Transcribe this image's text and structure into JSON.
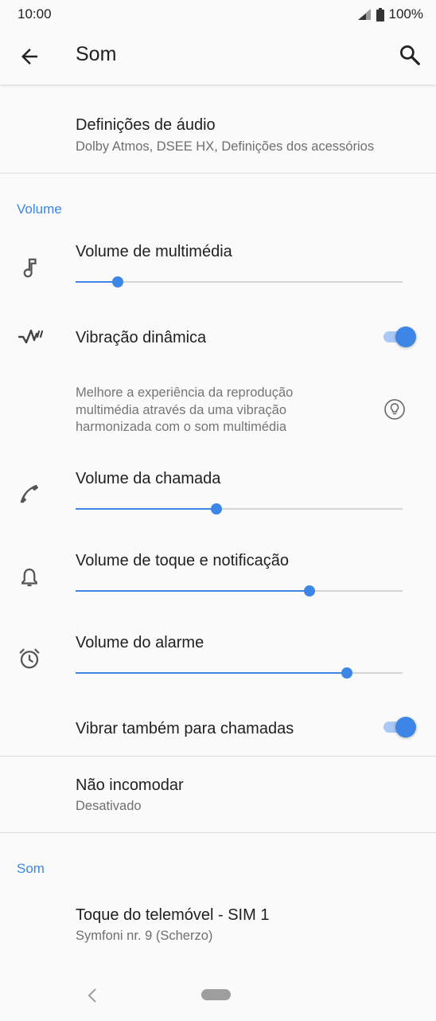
{
  "status_bar": {
    "time": "10:00",
    "battery": "100%"
  },
  "app_bar": {
    "title": "Som"
  },
  "audio_settings": {
    "title": "Definições de áudio",
    "subtitle": "Dolby Atmos, DSEE HX, Definições dos acessórios"
  },
  "volume_section": {
    "header": "Volume",
    "media": {
      "label": "Volume de multimédia",
      "level": 0.13
    },
    "dynamic_vibration": {
      "label": "Vibração dinâmica",
      "enabled": true,
      "description": "Melhore a experiência da reprodução multimédia através da uma vibração harmonizada com o som multimédia"
    },
    "call": {
      "label": "Volume da chamada",
      "level": 0.43
    },
    "ring": {
      "label": "Volume de toque e notificação",
      "level": 0.715
    },
    "alarm": {
      "label": "Volume do alarme",
      "level": 0.83
    },
    "vibrate_calls": {
      "label": "Vibrar também para chamadas",
      "enabled": true
    }
  },
  "do_not_disturb": {
    "title": "Não incomodar",
    "subtitle": "Desativado"
  },
  "sound_section": {
    "header": "Som",
    "ringtone": {
      "title": "Toque do telemóvel - SIM 1",
      "subtitle": "Symfoni nr. 9 (Scherzo)"
    }
  },
  "colors": {
    "accent": "#3d86e6",
    "background": "#fafafa"
  },
  "icons": [
    "signal-icon",
    "battery-icon",
    "back-arrow-icon",
    "search-icon",
    "music-note-icon",
    "vibration-icon",
    "lightbulb-icon",
    "phone-icon",
    "bell-icon",
    "alarm-clock-icon",
    "nav-back-icon",
    "nav-home-pill"
  ]
}
